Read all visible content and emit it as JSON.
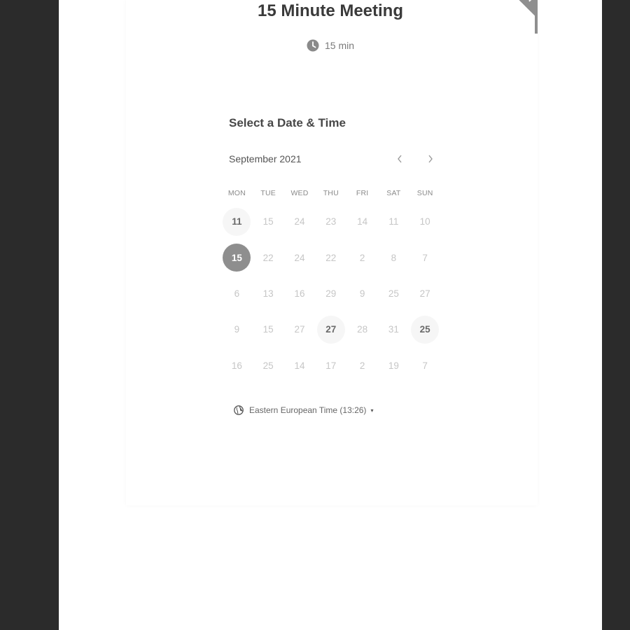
{
  "meeting": {
    "title": "15 Minute Meeting",
    "duration": "15 min",
    "ribbon_text": "N"
  },
  "calendar": {
    "heading": "Select a Date & Time",
    "month": "September 2021",
    "prev_icon": "chevron-left-icon",
    "next_icon": "chevron-right-icon",
    "weekdays": [
      "MON",
      "TUE",
      "WED",
      "THU",
      "FRI",
      "SAT",
      "SUN"
    ],
    "rows": [
      [
        {
          "d": "11",
          "s": "available"
        },
        {
          "d": "15",
          "s": "disabled"
        },
        {
          "d": "24",
          "s": "disabled"
        },
        {
          "d": "23",
          "s": "disabled"
        },
        {
          "d": "14",
          "s": "disabled"
        },
        {
          "d": "11",
          "s": "disabled"
        },
        {
          "d": "10",
          "s": "disabled"
        }
      ],
      [
        {
          "d": "15",
          "s": "selected"
        },
        {
          "d": "22",
          "s": "disabled"
        },
        {
          "d": "24",
          "s": "disabled"
        },
        {
          "d": "22",
          "s": "disabled"
        },
        {
          "d": "2",
          "s": "disabled"
        },
        {
          "d": "8",
          "s": "disabled"
        },
        {
          "d": "7",
          "s": "disabled"
        }
      ],
      [
        {
          "d": "6",
          "s": "disabled"
        },
        {
          "d": "13",
          "s": "disabled"
        },
        {
          "d": "16",
          "s": "disabled"
        },
        {
          "d": "29",
          "s": "disabled"
        },
        {
          "d": "9",
          "s": "disabled"
        },
        {
          "d": "25",
          "s": "disabled"
        },
        {
          "d": "27",
          "s": "disabled"
        }
      ],
      [
        {
          "d": "9",
          "s": "disabled"
        },
        {
          "d": "15",
          "s": "disabled"
        },
        {
          "d": "27",
          "s": "disabled"
        },
        {
          "d": "27",
          "s": "available"
        },
        {
          "d": "28",
          "s": "disabled"
        },
        {
          "d": "31",
          "s": "disabled"
        },
        {
          "d": "25",
          "s": "available"
        }
      ],
      [
        {
          "d": "16",
          "s": "disabled"
        },
        {
          "d": "25",
          "s": "disabled"
        },
        {
          "d": "14",
          "s": "disabled"
        },
        {
          "d": "17",
          "s": "disabled"
        },
        {
          "d": "2",
          "s": "disabled"
        },
        {
          "d": "19",
          "s": "disabled"
        },
        {
          "d": "7",
          "s": "disabled"
        }
      ]
    ]
  },
  "timezone": {
    "label": "Eastern European Time (13:26)",
    "icon": "globe-icon",
    "caret": "▾"
  },
  "colors": {
    "accent": "#8e8e8e",
    "available_bg": "#f6f6f6",
    "frame": "#2b2b2b"
  }
}
